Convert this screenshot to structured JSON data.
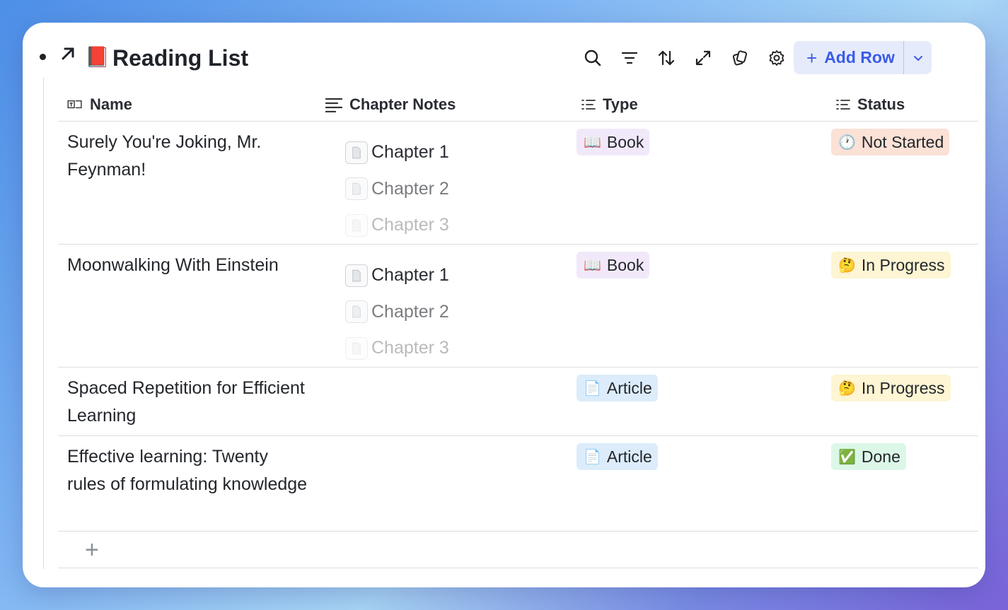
{
  "page": {
    "title": "Reading List",
    "title_emoji": "📕"
  },
  "toolbar": {
    "icons": [
      "search-icon",
      "filter-icon",
      "sort-icon",
      "expand-icon",
      "copy-icon",
      "gear-icon"
    ],
    "add_row_label": "Add Row",
    "add_row_plus": "+"
  },
  "table": {
    "columns": [
      {
        "label": "Name",
        "icon": "title-field-icon"
      },
      {
        "label": "Chapter Notes",
        "icon": "text-field-icon"
      },
      {
        "label": "Type",
        "icon": "list-field-icon"
      },
      {
        "label": "Status",
        "icon": "list-field-icon"
      }
    ],
    "rows": [
      {
        "name": "Surely You're Joking, Mr. Feynman!",
        "notes": [
          "Chapter 1",
          "Chapter 2",
          "Chapter 3"
        ],
        "type": {
          "emoji": "📖",
          "label": "Book"
        },
        "status": {
          "emoji": "🕐",
          "label": "Not Started"
        }
      },
      {
        "name": "Moonwalking With Einstein",
        "notes": [
          "Chapter 1",
          "Chapter 2",
          "Chapter 3"
        ],
        "type": {
          "emoji": "📖",
          "label": "Book"
        },
        "status": {
          "emoji": "🤔",
          "label": "In Progress"
        }
      },
      {
        "name": "Spaced Repetition for Efficient Learning",
        "notes": [],
        "type": {
          "emoji": "📄",
          "label": "Article"
        },
        "status": {
          "emoji": "🤔",
          "label": "In Progress"
        }
      },
      {
        "name": "Effective learning: Twenty rules of formulating knowledge",
        "notes": [],
        "type": {
          "emoji": "📄",
          "label": "Article"
        },
        "status": {
          "emoji": "✅",
          "label": "Done"
        }
      }
    ],
    "add_row_icon": "+"
  },
  "colors": {
    "accent": "#3a5ce6",
    "book": "#f1e9fa",
    "article": "#dcecfa",
    "not_started": "#fbe1d6",
    "in_progress": "#fdf5d3",
    "done": "#dcf7e8"
  }
}
